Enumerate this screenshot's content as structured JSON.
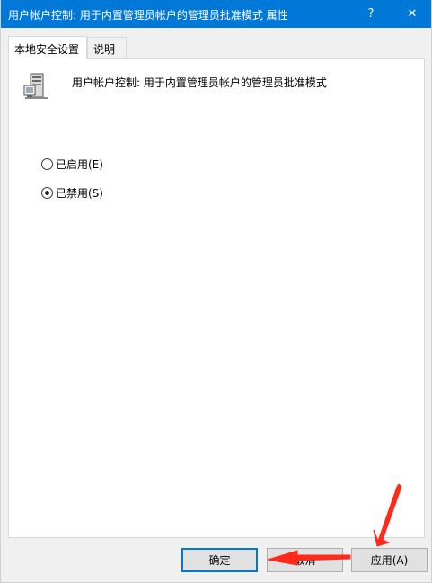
{
  "window": {
    "title": "用户帐户控制: 用于内置管理员帐户的管理员批准模式 属性",
    "help_label": "?",
    "close_label": "✕"
  },
  "tabs": [
    {
      "label": "本地安全设置",
      "active": true
    },
    {
      "label": "说明",
      "active": false
    }
  ],
  "policy": {
    "icon": "server-computer-icon",
    "name": "用户帐户控制: 用于内置管理员帐户的管理员批准模式"
  },
  "options": [
    {
      "label": "已启用(E)",
      "selected": false
    },
    {
      "label": "已禁用(S)",
      "selected": true
    }
  ],
  "buttons": {
    "ok": "确定",
    "cancel": "取消",
    "apply": "应用(A)"
  },
  "annotations": {
    "arrow_color": "#ff2a1a"
  },
  "colors": {
    "titlebar": "#0078d7",
    "focus_border": "#0078d7"
  }
}
